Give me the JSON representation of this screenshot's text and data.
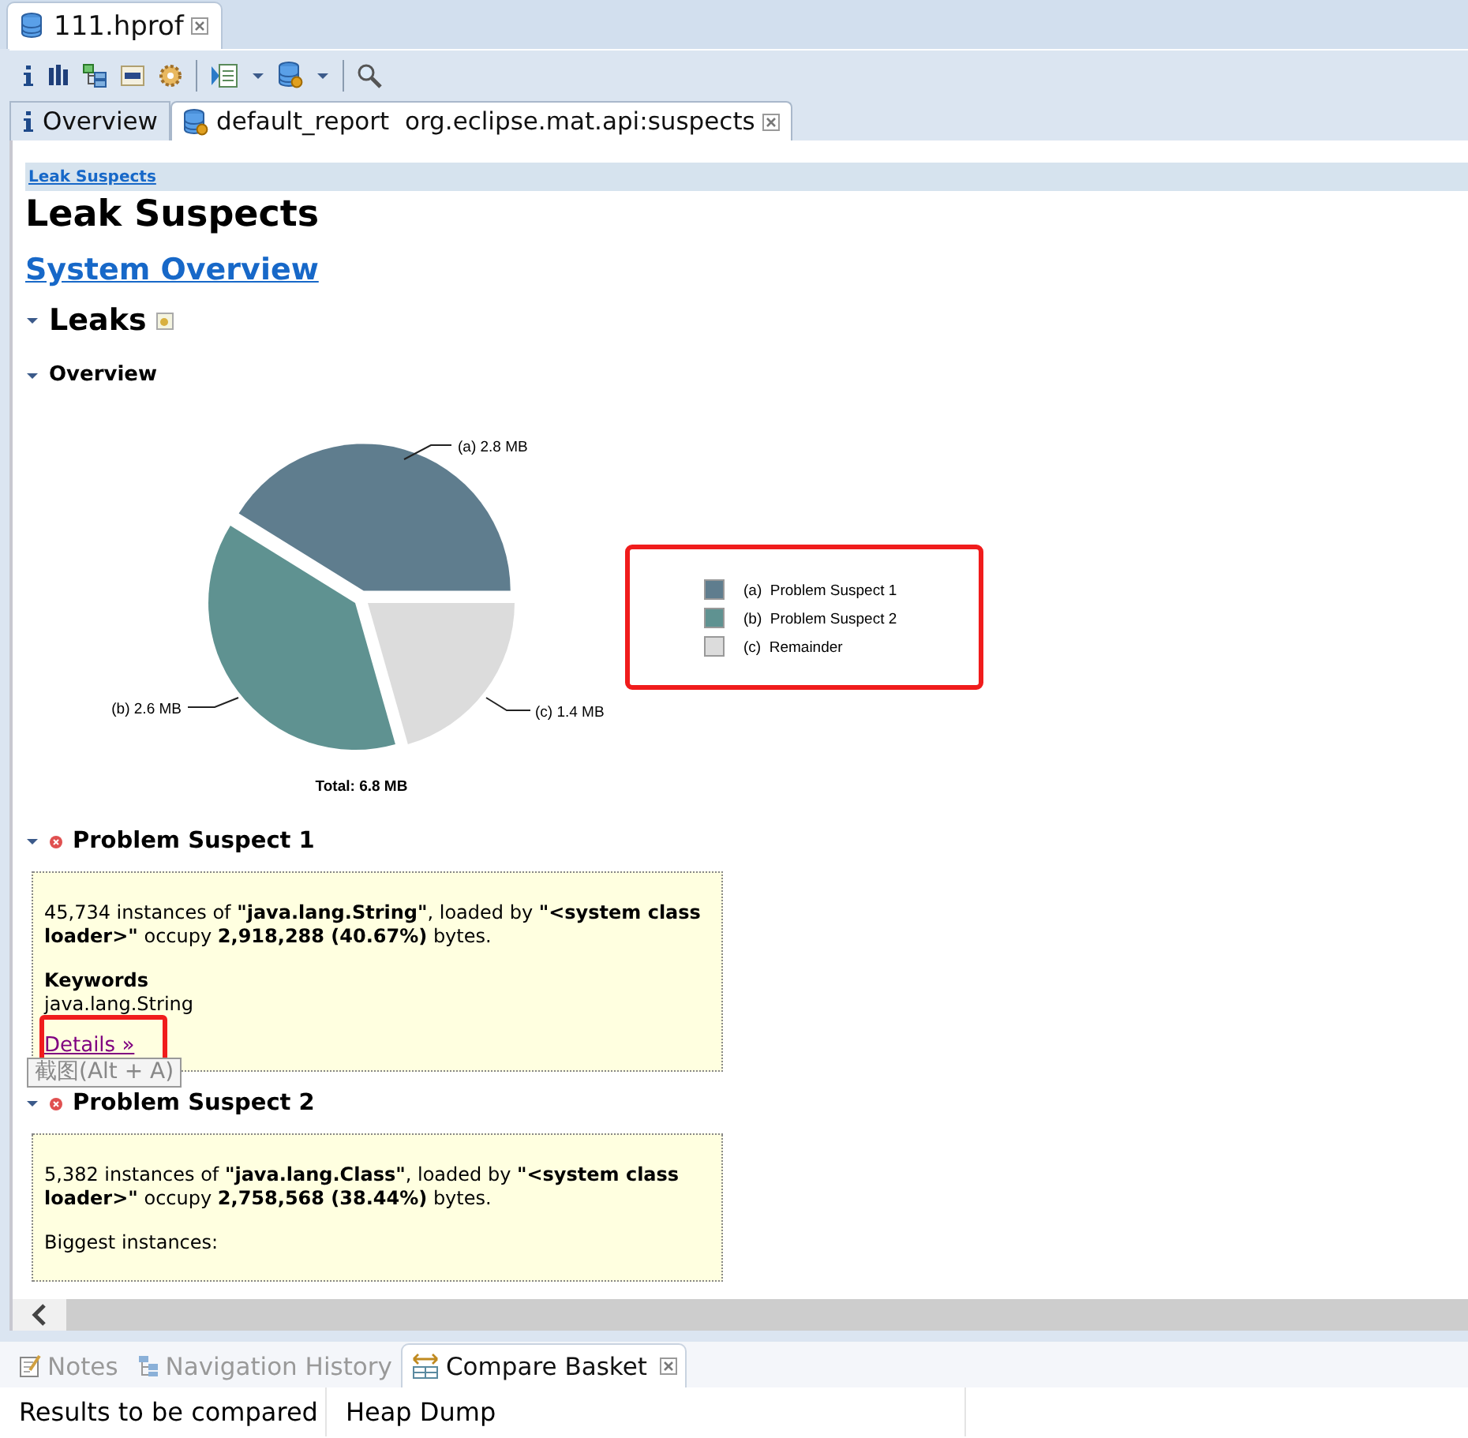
{
  "editor_tabs": [
    {
      "label": "111.hprof",
      "selected": true,
      "closable": true
    }
  ],
  "report_tabs": [
    {
      "label": "Overview",
      "selected": false,
      "closable": false
    },
    {
      "label": "default_report  org.eclipse.mat.api:suspects",
      "selected": true,
      "closable": true
    }
  ],
  "breadcrumb": "Leak Suspects",
  "title": "Leak Suspects",
  "system_overview_link": "System Overview",
  "leaks": {
    "title": "Leaks",
    "expanded": true,
    "overview": {
      "title": "Overview",
      "expanded": true,
      "chart_data": {
        "type": "pie",
        "title": "Total: 6.8 MB",
        "values": [
          2.8,
          2.6,
          1.4
        ],
        "value_labels": [
          "(a)  2.8 MB",
          "(b)  2.6 MB",
          "(c)  1.4 MB"
        ]
      },
      "legend": {
        "highlighted": true,
        "items": [
          {
            "marker": "(a)",
            "label": "Problem Suspect 1",
            "color": "#5f7d8e"
          },
          {
            "marker": "(b)",
            "label": "Problem Suspect 2",
            "color": "#5f9291"
          },
          {
            "marker": "(c)",
            "label": "Remainder",
            "color": "#dcdcdc"
          }
        ]
      }
    }
  },
  "suspects": [
    {
      "title": "Problem Suspect 1",
      "expanded": true,
      "description": "45,734 instances of **\"java.lang.String\"**, loaded by **\"<system class loader>\"** occupy **2,918,288 (40.67%)** bytes.",
      "keywords_label": "Keywords",
      "keywords": "java.lang.String",
      "link": {
        "label": "Details »",
        "highlighted": true
      }
    },
    {
      "title": "Problem Suspect 2",
      "expanded": true,
      "description": "5,382 instances of **\"java.lang.Class\"**, loaded by **\"<system class loader>\"** occupy **2,758,568 (38.44%)** bytes.",
      "note": "Biggest instances:"
    }
  ],
  "tooltip": "截图(Alt + A)",
  "bottom_tabs": [
    {
      "label": "Notes",
      "selected": false,
      "closable": false
    },
    {
      "label": "Navigation History",
      "selected": false,
      "closable": false
    },
    {
      "label": "Compare Basket",
      "selected": true,
      "closable": true
    }
  ],
  "compare_table": {
    "columns": [
      "Results to be compared",
      "Heap Dump"
    ]
  }
}
